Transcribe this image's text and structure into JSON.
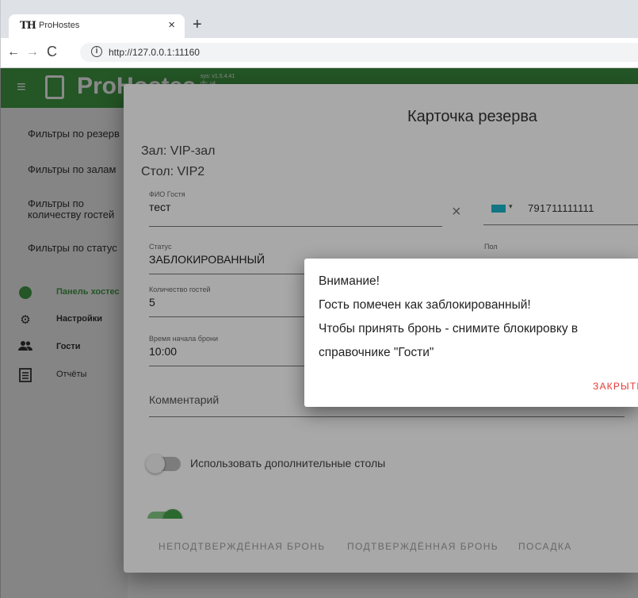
{
  "browser": {
    "tab_favicon": "TH",
    "tab_title": "ProHostes",
    "tab_close": "×",
    "new_tab": "+",
    "back": "←",
    "forward": "→",
    "reload": "C",
    "info": "i",
    "url": "http://127.0.0.1:11160"
  },
  "app": {
    "brand": "ProHostes",
    "version_line1": "sys: v1.5.4.41",
    "version_line2": "db: v4",
    "menu_icon": "≡"
  },
  "sidebar": {
    "filters": [
      "Фильтры по резерв",
      "Фильтры по залам",
      "Фильтры по количеству гостей",
      "Фильтры по статус"
    ],
    "nav": [
      {
        "label": "Панель хостес",
        "icon": "clock-icon"
      },
      {
        "label": "Настройки",
        "icon": "gear-icon"
      },
      {
        "label": "Гости",
        "icon": "people-icon"
      },
      {
        "label": "Отчёты",
        "icon": "report-icon"
      }
    ]
  },
  "card": {
    "title": "Карточка резерва",
    "hall": "Зал: VIP-зал",
    "table": "Стол: VIP2",
    "guest_name_label": "ФИО Гостя",
    "guest_name_value": "тест",
    "clear": "×",
    "phone_caret": "▾",
    "phone_value": "791711111111",
    "status_label": "Статус",
    "status_value": "ЗАБЛОКИРОВАННЫЙ",
    "gender_label": "Пол",
    "guests_label": "Количество гостей",
    "guests_value": "5",
    "start_time_label": "Время начала брони",
    "start_time_value": "10:00",
    "comment_placeholder": "Комментарий",
    "toggle_extra_tables": "Использовать дополнительные столы",
    "toggle_extra_tables_on": false,
    "toggle_second_on": true,
    "footer_buttons": [
      "НЕПОДТВЕРЖДЁННАЯ БРОНЬ",
      "ПОДТВЕРЖДЁННАЯ БРОНЬ",
      "ПОСАДКА"
    ]
  },
  "alert": {
    "lines": [
      "Внимание!",
      "Гость помечен как заблокированный!",
      "Чтобы принять бронь - снимите блокировку в",
      "справочнике \"Гости\""
    ],
    "close_label": "ЗАКРЫТЬ"
  },
  "colors": {
    "appbar": "#43a047",
    "accent": "#43a047",
    "danger": "#e53935"
  }
}
